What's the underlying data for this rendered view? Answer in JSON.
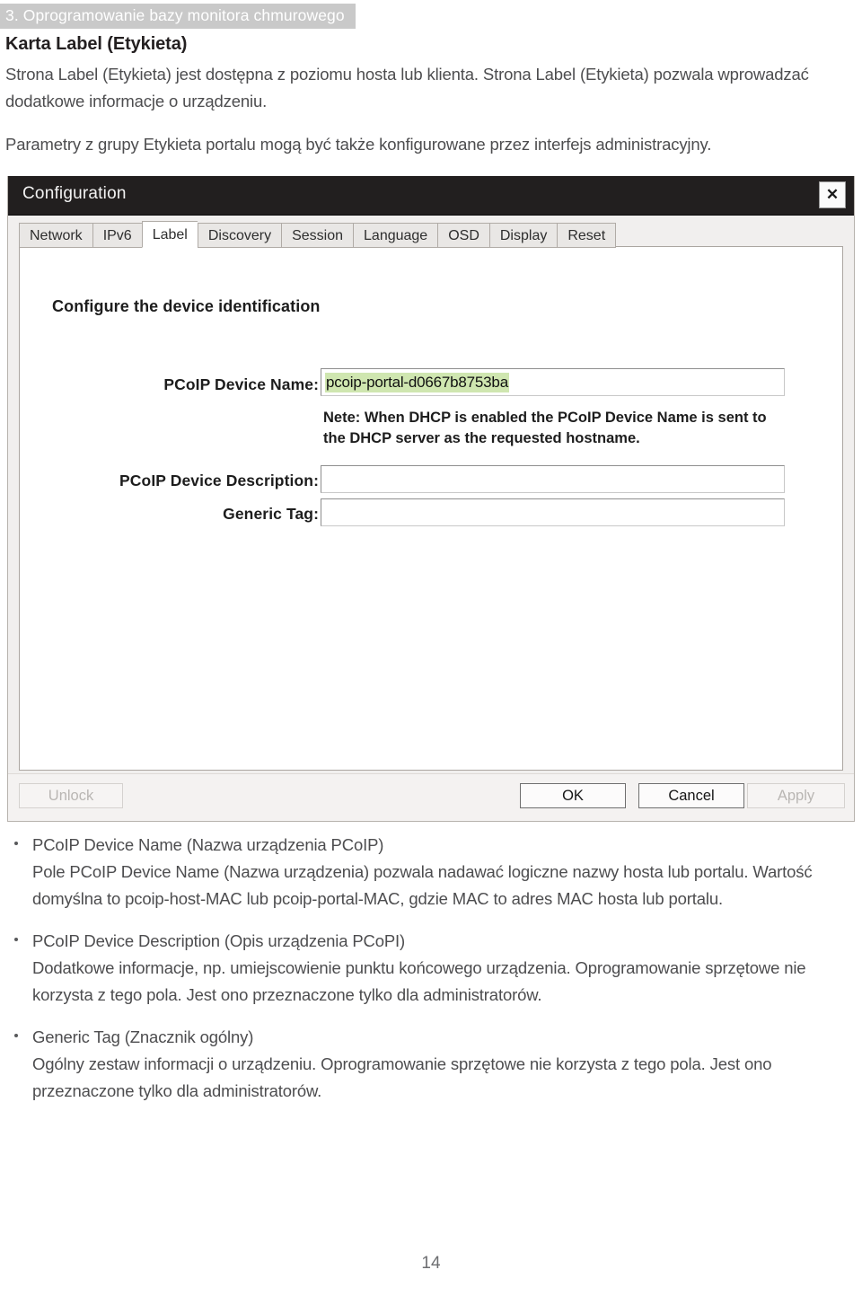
{
  "document": {
    "chapter_banner": "3. Oprogramowanie bazy monitora chmurowego",
    "heading": "Karta Label (Etykieta)",
    "paragraph_1": "Strona Label (Etykieta) jest dostępna z poziomu hosta lub klienta. Strona Label (Etykieta) pozwala wprowadzać dodatkowe informacje o urządzeniu.",
    "paragraph_2": "Parametry z grupy Etykieta portalu mogą być także konfigurowane przez interfejs administracyjny.",
    "page_number": "14"
  },
  "dialog": {
    "title": "Configuration",
    "close_label": "✕",
    "tabs": [
      {
        "label": "Network",
        "active": false
      },
      {
        "label": "IPv6",
        "active": false
      },
      {
        "label": "Label",
        "active": true
      },
      {
        "label": "Discovery",
        "active": false
      },
      {
        "label": "Session",
        "active": false
      },
      {
        "label": "Language",
        "active": false
      },
      {
        "label": "OSD",
        "active": false
      },
      {
        "label": "Display",
        "active": false
      },
      {
        "label": "Reset",
        "active": false
      }
    ],
    "panel": {
      "heading": "Configure the device identification",
      "fields": {
        "device_name": {
          "label": "PCoIP Device Name:",
          "value": "pcoip-portal-d0667b8753ba",
          "highlight_color": "#cfe6b0"
        },
        "device_description": {
          "label": "PCoIP Device Description:",
          "value": ""
        },
        "generic_tag": {
          "label": "Generic Tag:",
          "value": ""
        }
      },
      "note": "Nete: When DHCP is enabled the PCoIP Device Name is sent to the DHCP server as the requested hostname."
    },
    "buttons": {
      "unlock": "Unlock",
      "ok": "OK",
      "cancel": "Cancel",
      "apply": "Apply"
    }
  },
  "bullets": [
    {
      "title": "PCoIP Device Name (Nazwa urządzenia PCoIP)",
      "body": "Pole PCoIP Device Name (Nazwa urządzenia) pozwala nadawać logiczne nazwy hosta lub portalu. Wartość domyślna to pcoip-host-MAC lub pcoip-portal-MAC, gdzie MAC to adres MAC hosta lub portalu."
    },
    {
      "title": "PCoIP Device Description (Opis urządzenia PCoPI)",
      "body": "Dodatkowe informacje, np. umiejscowienie punktu końcowego urządzenia. Oprogramowanie sprzętowe nie korzysta z tego pola. Jest ono przeznaczone tylko dla administratorów."
    },
    {
      "title": "Generic Tag (Znacznik ogólny)",
      "body": "Ogólny zestaw informacji o urządzeniu. Oprogramowanie sprzętowe nie korzysta z tego pola. Jest ono przeznaczone tylko dla administratorów."
    }
  ]
}
